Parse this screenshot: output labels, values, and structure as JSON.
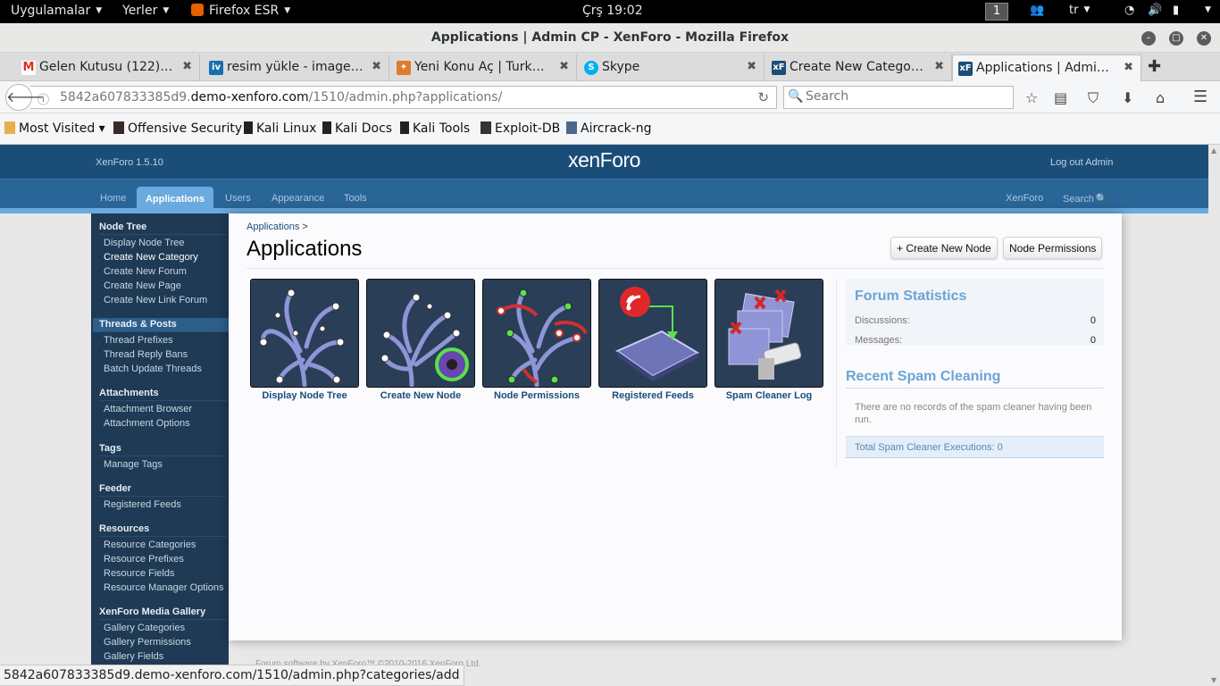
{
  "topbar": {
    "apps": "Uygulamalar",
    "places": "Yerler",
    "firefox": "Firefox ESR",
    "clock": "Çrş 19:02",
    "workspace": "1",
    "lang": "tr"
  },
  "window": {
    "title": "Applications | Admin CP - XenForo - Mozilla Firefox"
  },
  "tabs": [
    {
      "label": "Gelen Kutusu (122) - ...",
      "icon": "M",
      "color": "#d93025"
    },
    {
      "label": "resim yükle - image u...",
      "icon": "iv",
      "color": "#1a6fb0"
    },
    {
      "label": "Yeni Konu Aç | Turkm...",
      "icon": "✦",
      "color": "#e07b2a"
    },
    {
      "label": "Skype",
      "icon": "S",
      "color": "#00aff0"
    },
    {
      "label": "Create New Category ...",
      "icon": "xF",
      "color": "#1b4d79"
    },
    {
      "label": "Applications | Admin ...",
      "icon": "xF",
      "color": "#1b4d79"
    }
  ],
  "nav": {
    "url_prefix": "5842a607833385d9.",
    "url_domain": "demo-xenforo.com",
    "url_path": "/1510/admin.php?applications/",
    "search_placeholder": "Search"
  },
  "bookmarks": [
    "Most Visited ▾",
    "Offensive Security",
    "Kali Linux",
    "Kali Docs",
    "Kali Tools",
    "Exploit-DB",
    "Aircrack-ng"
  ],
  "xf": {
    "version": "XenForo 1.5.10",
    "logo": "xenForo",
    "logout": "Log out Admin",
    "nav": [
      "Home",
      "Applications",
      "Users",
      "Appearance",
      "Tools"
    ],
    "nav_right": [
      "XenForo",
      "Search"
    ]
  },
  "sidebar": {
    "sections": [
      {
        "title": "Node Tree",
        "items": [
          "Display Node Tree",
          "Create New Category",
          "Create New Forum",
          "Create New Page",
          "Create New Link Forum"
        ]
      },
      {
        "title": "Threads & Posts",
        "items": [
          "Thread Prefixes",
          "Thread Reply Bans",
          "Batch Update Threads"
        ]
      },
      {
        "title": "Attachments",
        "items": [
          "Attachment Browser",
          "Attachment Options"
        ]
      },
      {
        "title": "Tags",
        "items": [
          "Manage Tags"
        ]
      },
      {
        "title": "Feeder",
        "items": [
          "Registered Feeds"
        ]
      },
      {
        "title": "Resources",
        "items": [
          "Resource Categories",
          "Resource Prefixes",
          "Resource Fields",
          "Resource Manager Options"
        ]
      },
      {
        "title": "XenForo Media Gallery",
        "items": [
          "Gallery Categories",
          "Gallery Permissions",
          "Gallery Fields"
        ]
      }
    ]
  },
  "main": {
    "breadcrumb": "Applications",
    "breadcrumb_sep": ">",
    "title": "Applications",
    "buttons": [
      "+ Create New Node",
      "Node Permissions"
    ],
    "apps": [
      "Display Node Tree",
      "Create New Node",
      "Node Permissions",
      "Registered Feeds",
      "Spam Cleaner Log"
    ]
  },
  "stats": {
    "title": "Forum Statistics",
    "rows": [
      {
        "label": "Discussions:",
        "value": "0"
      },
      {
        "label": "Messages:",
        "value": "0"
      }
    ]
  },
  "spam": {
    "title": "Recent Spam Cleaning",
    "message": "There are no records of the spam cleaner having been run.",
    "footer": "Total Spam Cleaner Executions: 0"
  },
  "footer": "Forum software by XenForo™ ©2010-2016 XenForo Ltd.",
  "statusbar": "5842a607833385d9.demo-xenforo.com/1510/admin.php?categories/add"
}
